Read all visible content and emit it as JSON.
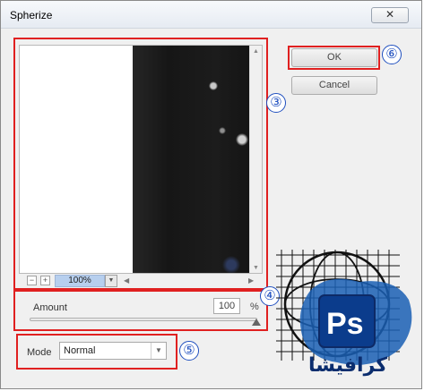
{
  "window": {
    "title": "Spherize",
    "close_glyph": "✕"
  },
  "preview": {
    "zoom_level": "100%",
    "zoom_out_glyph": "−",
    "zoom_in_glyph": "+"
  },
  "buttons": {
    "ok_label": "OK",
    "cancel_label": "Cancel"
  },
  "amount": {
    "label": "Amount",
    "value": "100",
    "unit": "%",
    "slider_fraction": 1.0
  },
  "mode": {
    "label": "Mode",
    "value": "Normal"
  },
  "annotations": [
    "③",
    "④",
    "⑤",
    "⑥"
  ],
  "logo": {
    "ps_text": "Ps",
    "arabic_text": "كرافيشا"
  },
  "colors": {
    "annotation_red": "#e02020",
    "annotation_blue": "#1f4fbf",
    "ps_blue": "#0b3c8c",
    "zoom_highlight": "#b7cfee"
  }
}
